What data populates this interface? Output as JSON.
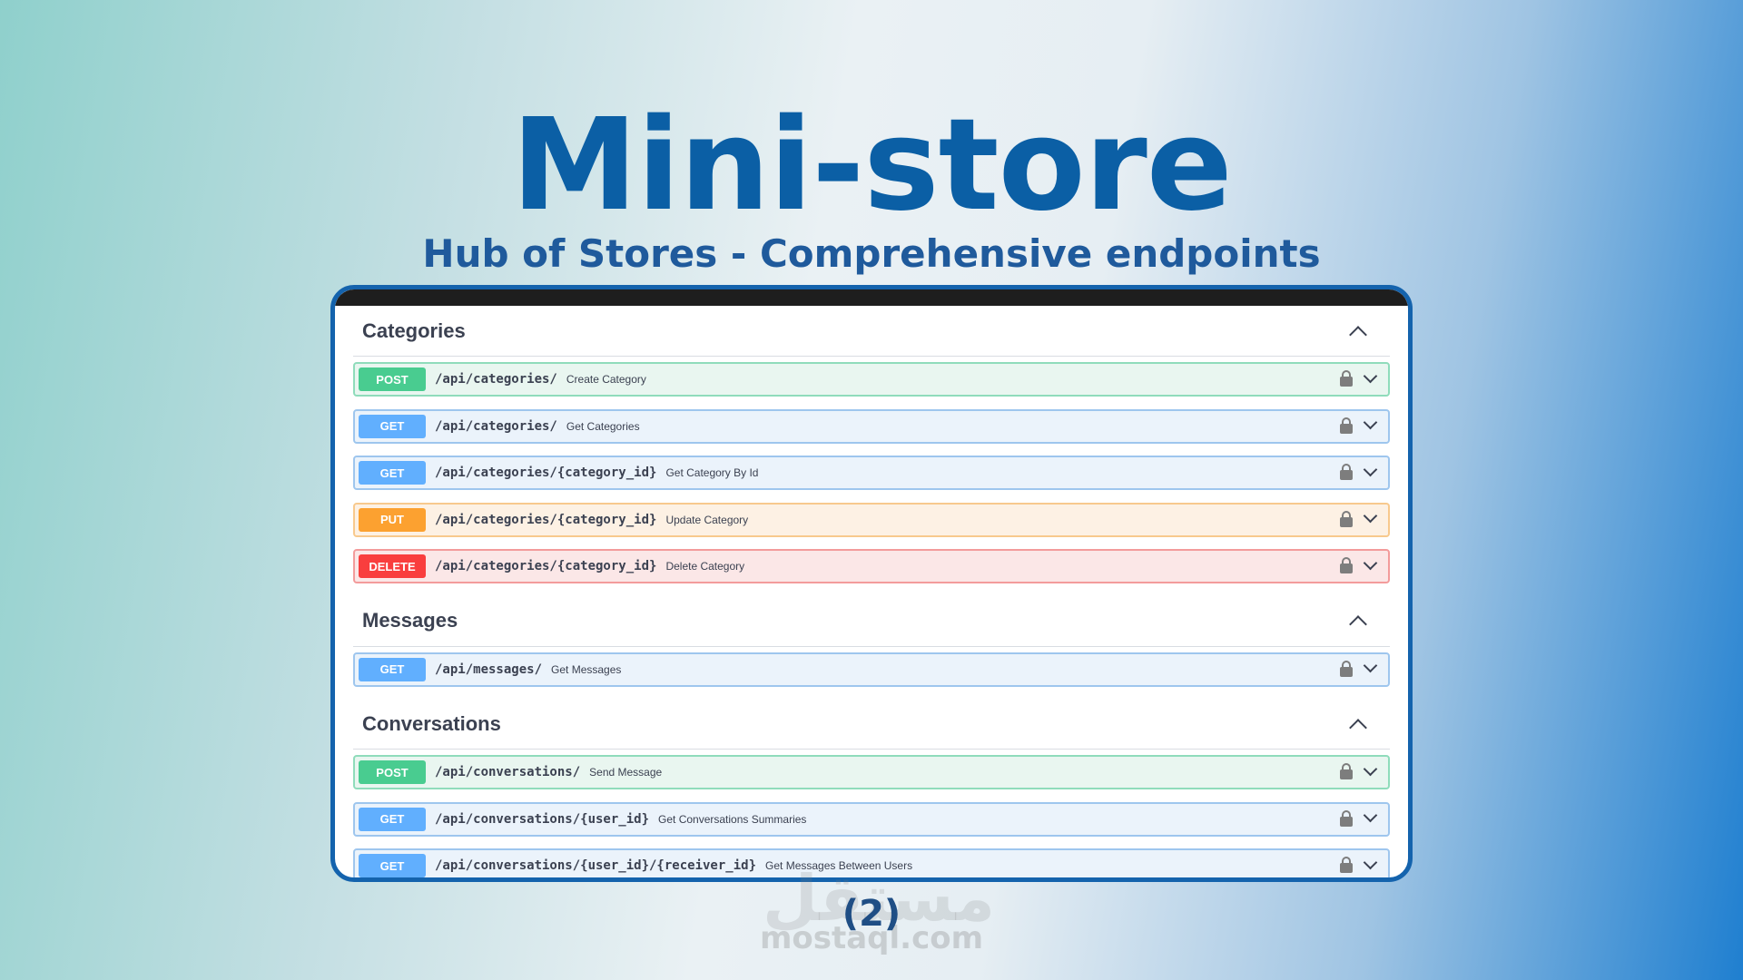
{
  "header": {
    "title": "Mini-store",
    "subtitle": "Hub of Stores - Comprehensive endpoints"
  },
  "sections": [
    {
      "title": "Categories",
      "operations": [
        {
          "method": "POST",
          "path": "/api/categories/",
          "summary": "Create Category"
        },
        {
          "method": "GET",
          "path": "/api/categories/",
          "summary": "Get Categories"
        },
        {
          "method": "GET",
          "path": "/api/categories/{category_id}",
          "summary": "Get Category By Id"
        },
        {
          "method": "PUT",
          "path": "/api/categories/{category_id}",
          "summary": "Update Category"
        },
        {
          "method": "DELETE",
          "path": "/api/categories/{category_id}",
          "summary": "Delete Category"
        }
      ]
    },
    {
      "title": "Messages",
      "operations": [
        {
          "method": "GET",
          "path": "/api/messages/",
          "summary": "Get Messages"
        }
      ]
    },
    {
      "title": "Conversations",
      "operations": [
        {
          "method": "POST",
          "path": "/api/conversations/",
          "summary": "Send Message"
        },
        {
          "method": "GET",
          "path": "/api/conversations/{user_id}",
          "summary": "Get Conversations Summaries"
        },
        {
          "method": "GET",
          "path": "/api/conversations/{user_id}/{receiver_id}",
          "summary": "Get Messages Between Users"
        }
      ]
    }
  ],
  "footer": {
    "page_number": "(2)",
    "watermark_ar": "مستقل",
    "watermark_en": "mostaql.com"
  },
  "colors": {
    "title": "#0b5fa5",
    "frame_border": "#1463ad",
    "post": "#49cc90",
    "get": "#61affe",
    "put": "#fca130",
    "delete": "#f93e3e"
  },
  "icons": {
    "lock": "lock-icon",
    "expand": "chevron-down-icon",
    "collapse": "chevron-up-icon"
  }
}
